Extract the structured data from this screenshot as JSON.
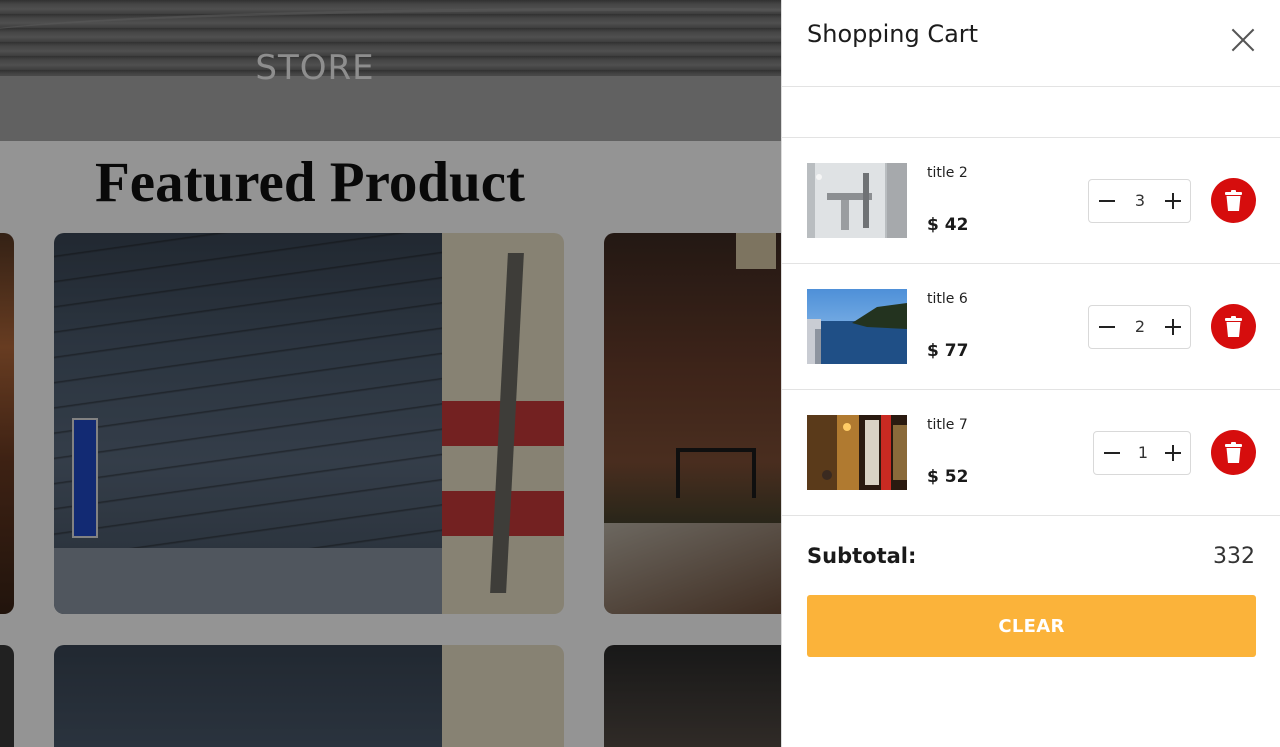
{
  "store": {
    "brand": "STORE",
    "featured_heading": "Featured Product"
  },
  "cart": {
    "title": "Shopping Cart",
    "items": [
      {
        "title": "title 2",
        "price": "$ 42",
        "quantity": "3"
      },
      {
        "title": "title 6",
        "price": "$ 77",
        "quantity": "2"
      },
      {
        "title": "title 7",
        "price": "$ 52",
        "quantity": "1"
      }
    ],
    "subtotal_label": "Subtotal:",
    "subtotal_value": "332",
    "clear_label": "CLEAR"
  },
  "colors": {
    "accent": "#fbb33a",
    "delete": "#d60d0d",
    "overlay": "rgba(0,0,0,0.42)"
  },
  "icons": {
    "close": "close-icon",
    "delete": "trash-icon",
    "decrease": "minus-icon",
    "increase": "plus-icon"
  }
}
